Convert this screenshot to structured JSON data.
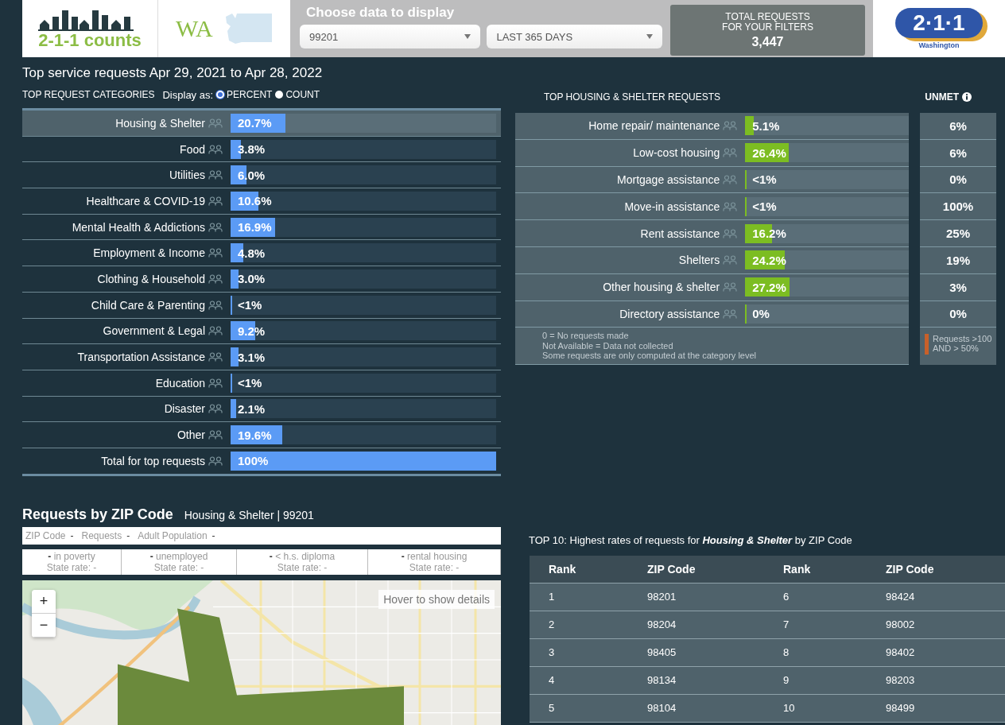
{
  "header": {
    "logo_text": "2-1-1 counts",
    "state": "WA",
    "choose_title": "Choose data to display",
    "zip_select": "99201",
    "period_select": "LAST 365 DAYS",
    "total_label_1": "TOTAL REQUESTS",
    "total_label_2": "FOR YOUR FILTERS",
    "total_value": "3,447",
    "brand_number": "2·1·1",
    "brand_region": "Washington"
  },
  "title": "Top service requests Apr 29, 2021 to Apr 28, 2022",
  "categories_heading": "TOP REQUEST CATEGORIES",
  "display_as_label": "Display as:",
  "display_options": [
    {
      "label": "PERCENT",
      "selected": true
    },
    {
      "label": "COUNT",
      "selected": false
    }
  ],
  "categories": [
    {
      "name": "Housing & Shelter",
      "value": "20.7%",
      "level": 0.207,
      "selected": true
    },
    {
      "name": "Food",
      "value": "3.8%",
      "level": 0.038,
      "selected": false
    },
    {
      "name": "Utilities",
      "value": "6.0%",
      "level": 0.06,
      "selected": false
    },
    {
      "name": "Healthcare & COVID-19",
      "value": "10.6%",
      "level": 0.106,
      "selected": false
    },
    {
      "name": "Mental Health & Addictions",
      "value": "16.9%",
      "level": 0.169,
      "selected": false
    },
    {
      "name": "Employment & Income",
      "value": "4.8%",
      "level": 0.048,
      "selected": false
    },
    {
      "name": "Clothing & Household",
      "value": "3.0%",
      "level": 0.03,
      "selected": false
    },
    {
      "name": "Child Care & Parenting",
      "value": "<1%",
      "level": 0.005,
      "selected": false
    },
    {
      "name": "Government & Legal",
      "value": "9.2%",
      "level": 0.092,
      "selected": false
    },
    {
      "name": "Transportation Assistance",
      "value": "3.1%",
      "level": 0.031,
      "selected": false
    },
    {
      "name": "Education",
      "value": "<1%",
      "level": 0.005,
      "selected": false
    },
    {
      "name": "Disaster",
      "value": "2.1%",
      "level": 0.021,
      "selected": false
    },
    {
      "name": "Other",
      "value": "19.6%",
      "level": 0.196,
      "selected": false
    },
    {
      "name": "Total for top requests",
      "value": "100%",
      "level": 1,
      "selected": false
    }
  ],
  "housing_heading": "TOP HOUSING & SHELTER REQUESTS",
  "unmet_heading": "UNMET",
  "housing": [
    {
      "name": "Home repair/ maintenance",
      "value": "5.1%",
      "level": 0.051,
      "unmet": "6%"
    },
    {
      "name": "Low-cost housing",
      "value": "26.4%",
      "level": 0.264,
      "unmet": "6%"
    },
    {
      "name": "Mortgage assistance",
      "value": "<1%",
      "level": 0.005,
      "unmet": "0%"
    },
    {
      "name": "Move-in assistance",
      "value": "<1%",
      "level": 0.005,
      "unmet": "100%"
    },
    {
      "name": "Rent assistance",
      "value": "16.2%",
      "level": 0.162,
      "unmet": "25%"
    },
    {
      "name": "Shelters",
      "value": "24.2%",
      "level": 0.242,
      "unmet": "19%"
    },
    {
      "name": "Other housing & shelter",
      "value": "27.2%",
      "level": 0.272,
      "unmet": "3%"
    },
    {
      "name": "Directory assistance",
      "value": "0%",
      "level": 0,
      "unmet": "0%"
    }
  ],
  "notes": [
    "0 = No requests made",
    "Not Available = Data not collected",
    "Some requests are only computed at the category level"
  ],
  "unmet_legend": {
    "text_1": "Requests >100",
    "text_2": "AND > 50%",
    "color": "#c8602a"
  },
  "zip_section": {
    "title": "Requests by ZIP Code",
    "subtitle": "Housing & Shelter | 99201",
    "summary": [
      {
        "label": "ZIP Code",
        "value": "-"
      },
      {
        "label": "Requests",
        "value": "-"
      },
      {
        "label": "Adult Population",
        "value": "-"
      }
    ],
    "stats": [
      {
        "value": "-",
        "label": "in poverty",
        "state_rate": "State rate: -"
      },
      {
        "value": "-",
        "label": "unemployed",
        "state_rate": "State rate: -"
      },
      {
        "value": "-",
        "label": "< h.s. diploma",
        "state_rate": "State rate: -"
      },
      {
        "value": "-",
        "label": "rental housing",
        "state_rate": "State rate: -"
      }
    ],
    "zoom_in": "+",
    "zoom_out": "−",
    "hover_hint": "Hover to show details"
  },
  "top10": {
    "caption_before": "TOP 10: Highest rates of requests for ",
    "caption_category": "Housing & Shelter",
    "caption_after": " by ZIP Code",
    "columns": [
      "Rank",
      "ZIP Code",
      "Rank",
      "ZIP Code"
    ],
    "rows": [
      [
        "1",
        "98201",
        "6",
        "98424"
      ],
      [
        "2",
        "98204",
        "7",
        "98002"
      ],
      [
        "3",
        "98405",
        "8",
        "98402"
      ],
      [
        "4",
        "98134",
        "9",
        "98203"
      ],
      [
        "5",
        "98104",
        "10",
        "98499"
      ]
    ]
  }
}
